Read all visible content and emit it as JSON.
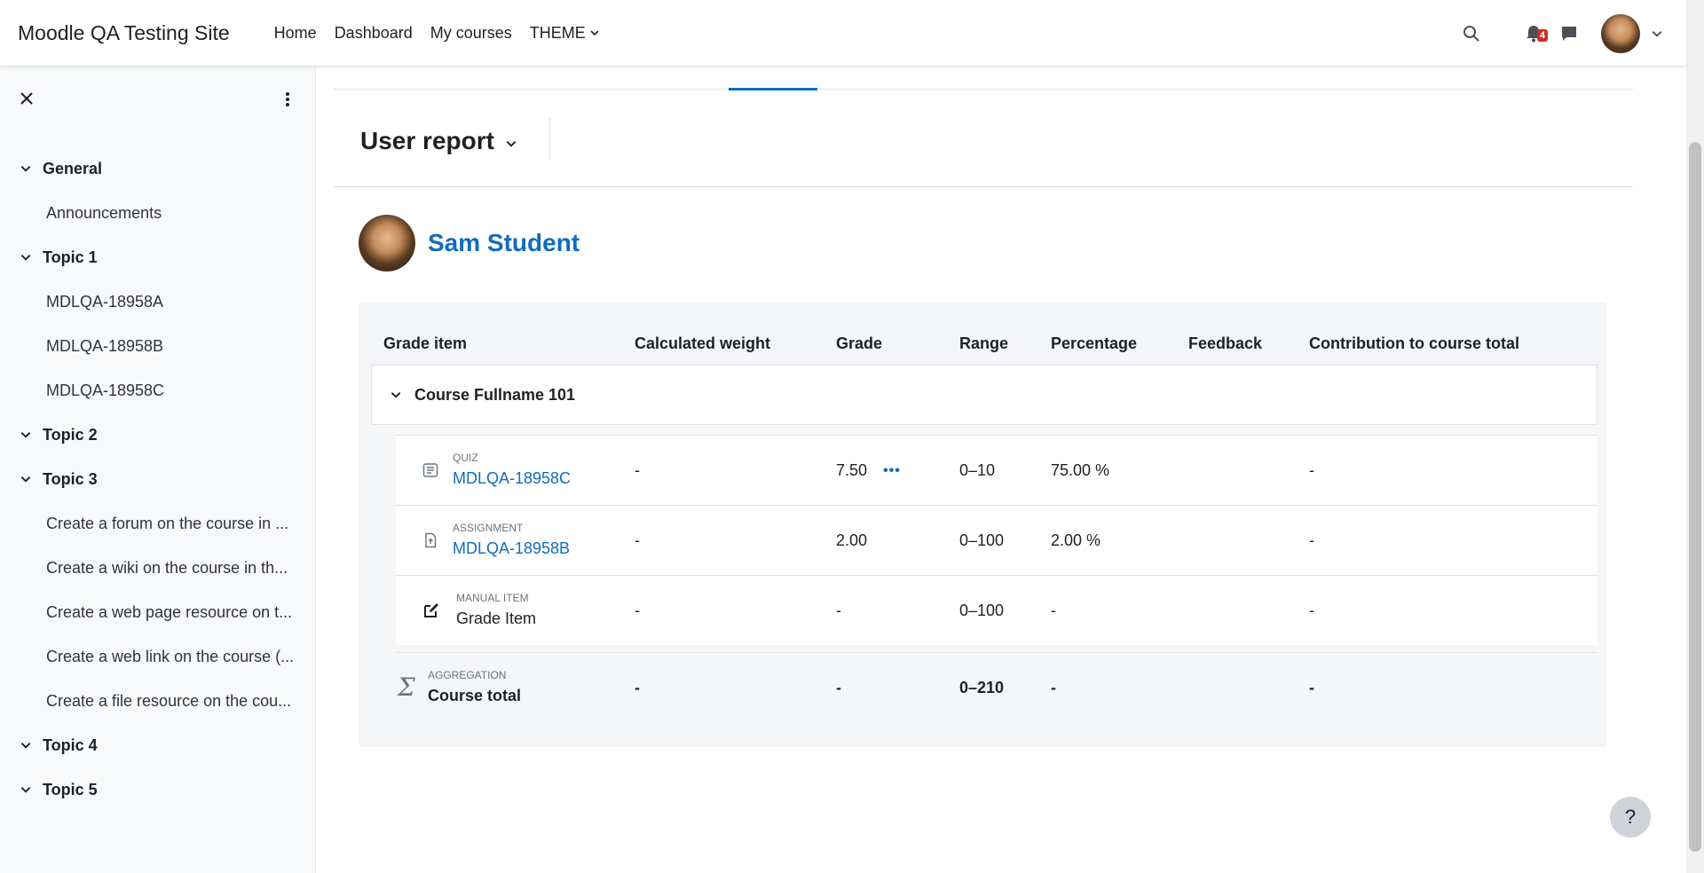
{
  "navbar": {
    "brand": "Moodle QA Testing Site",
    "links": [
      "Home",
      "Dashboard",
      "My courses"
    ],
    "theme_label": "THEME",
    "notification_count": "4"
  },
  "sidebar": {
    "sections": [
      {
        "title": "General",
        "items": [
          "Announcements"
        ]
      },
      {
        "title": "Topic 1",
        "items": [
          "MDLQA-18958A",
          "MDLQA-18958B",
          "MDLQA-18958C"
        ]
      },
      {
        "title": "Topic 2",
        "items": []
      },
      {
        "title": "Topic 3",
        "items": [
          "Create a forum on the course in ...",
          "Create a wiki on the course in th...",
          "Create a web page resource on t...",
          "Create a web link on the course (...",
          "Create a file resource on the cou..."
        ]
      },
      {
        "title": "Topic 4",
        "items": []
      },
      {
        "title": "Topic 5",
        "items": []
      }
    ]
  },
  "report": {
    "title": "User report",
    "user_name": "Sam Student"
  },
  "table": {
    "headers": [
      "Grade item",
      "Calculated weight",
      "Grade",
      "Range",
      "Percentage",
      "Feedback",
      "Contribution to course total"
    ],
    "category": "Course Fullname 101",
    "rows": [
      {
        "type": "QUIZ",
        "name": "MDLQA-18958C",
        "weight": "-",
        "grade": "7.50",
        "range": "0–10",
        "percentage": "75.00 %",
        "feedback": "",
        "contribution": "-"
      },
      {
        "type": "ASSIGNMENT",
        "name": "MDLQA-18958B",
        "weight": "-",
        "grade": "2.00",
        "range": "0–100",
        "percentage": "2.00 %",
        "feedback": "",
        "contribution": "-"
      },
      {
        "type": "MANUAL ITEM",
        "name": "Grade Item",
        "weight": "-",
        "grade": "-",
        "range": "0–100",
        "percentage": "-",
        "feedback": "",
        "contribution": "-"
      }
    ],
    "total": {
      "type": "AGGREGATION",
      "name": "Course total",
      "weight": "-",
      "grade": "-",
      "range": "0–210",
      "percentage": "-",
      "contribution": "-"
    }
  },
  "help_label": "?",
  "colors": {
    "link": "#0f6cbf",
    "badge": "#ca3120"
  },
  "icons": [
    "search-icon",
    "bell-icon",
    "chat-icon",
    "close-icon",
    "kebab-icon",
    "chevron-down-icon",
    "quiz-icon",
    "assignment-icon",
    "edit-icon",
    "sigma-icon"
  ]
}
